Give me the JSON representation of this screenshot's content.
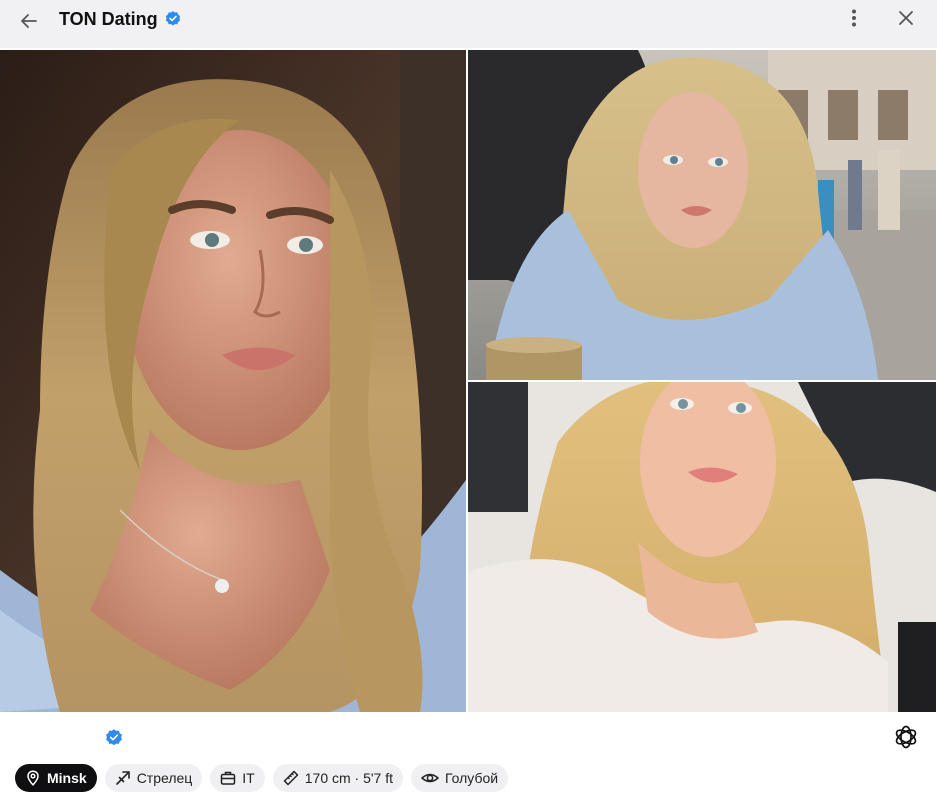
{
  "header": {
    "title": "TON Dating",
    "verified_icon": "verified-badge-icon",
    "back_icon": "arrow-left-icon",
    "menu_icon": "more-vertical-icon",
    "close_icon": "close-icon"
  },
  "photos": [
    {
      "name": "profile-photo-1",
      "description_icon": "photo"
    },
    {
      "name": "profile-photo-2",
      "description_icon": "photo"
    },
    {
      "name": "profile-photo-3",
      "description_icon": "photo"
    }
  ],
  "profile": {
    "verified_icon": "verified-badge-icon",
    "ai_icon": "openai-icon"
  },
  "chips": [
    {
      "icon": "location-pin-icon",
      "label": "Minsk",
      "active": true
    },
    {
      "icon": "zodiac-sagittarius-icon",
      "label": "Стрелец",
      "active": false
    },
    {
      "icon": "briefcase-icon",
      "label": "IT",
      "active": false
    },
    {
      "icon": "ruler-icon",
      "label": "170 cm · 5'7 ft",
      "active": false
    },
    {
      "icon": "eye-icon",
      "label": "Голубой",
      "active": false
    }
  ],
  "colors": {
    "header_bg": "#f1f1f4",
    "verified_blue": "#2f8bea",
    "chip_bg": "#f0f0f2",
    "chip_active_bg": "#0f0f12"
  }
}
